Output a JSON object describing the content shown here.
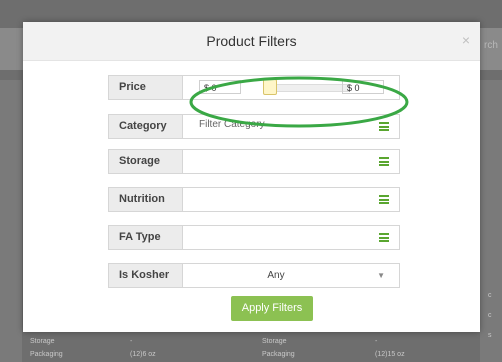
{
  "background": {
    "search_partial": "rch",
    "bottom_left": [
      {
        "label": "Storage",
        "value": "-"
      },
      {
        "label": "Packaging",
        "value": "(12)6 oz"
      }
    ],
    "bottom_right": [
      {
        "label": "Storage",
        "value": "-"
      },
      {
        "label": "Packaging",
        "value": "(12)15 oz"
      }
    ],
    "right_edge": [
      "c",
      "c",
      "s"
    ]
  },
  "modal": {
    "title": "Product Filters",
    "close_label": "×",
    "filters": {
      "price": {
        "label": "Price",
        "min_value": "$ 0",
        "max_value": "$ 0"
      },
      "category": {
        "label": "Category",
        "placeholder": "Filter Category"
      },
      "storage": {
        "label": "Storage"
      },
      "nutrition": {
        "label": "Nutrition"
      },
      "fa_type": {
        "label": "FA Type"
      },
      "is_kosher": {
        "label": "Is Kosher",
        "value": "Any",
        "caret": "▼"
      }
    },
    "apply_label": "Apply Filters"
  },
  "annotation": {
    "color": "#3aa845",
    "shape": "ellipse around price range"
  }
}
